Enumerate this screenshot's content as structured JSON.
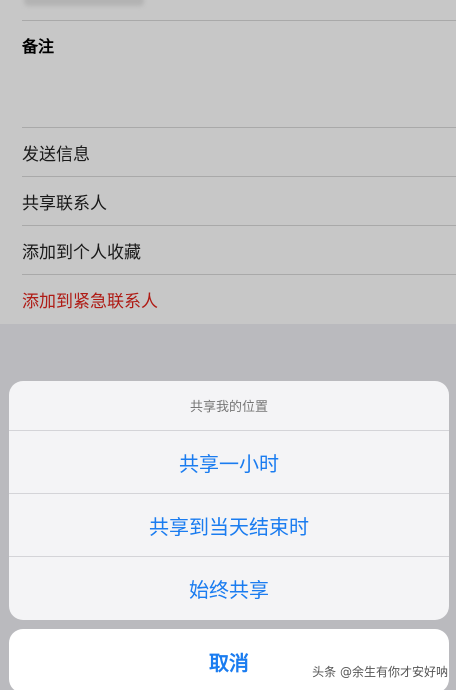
{
  "contact": {
    "notes_label": "备注",
    "actions": [
      {
        "label": "发送信息"
      },
      {
        "label": "共享联系人"
      },
      {
        "label": "添加到个人收藏"
      },
      {
        "label": "添加到紧急联系人"
      }
    ]
  },
  "action_sheet": {
    "title": "共享我的位置",
    "options": [
      {
        "label": "共享一小时"
      },
      {
        "label": "共享到当天结束时"
      },
      {
        "label": "始终共享"
      }
    ],
    "cancel_label": "取消"
  },
  "watermark": "头条 @余生有你才安好呐",
  "colors": {
    "accent": "#1a7cf0",
    "danger": "#e0231b"
  }
}
